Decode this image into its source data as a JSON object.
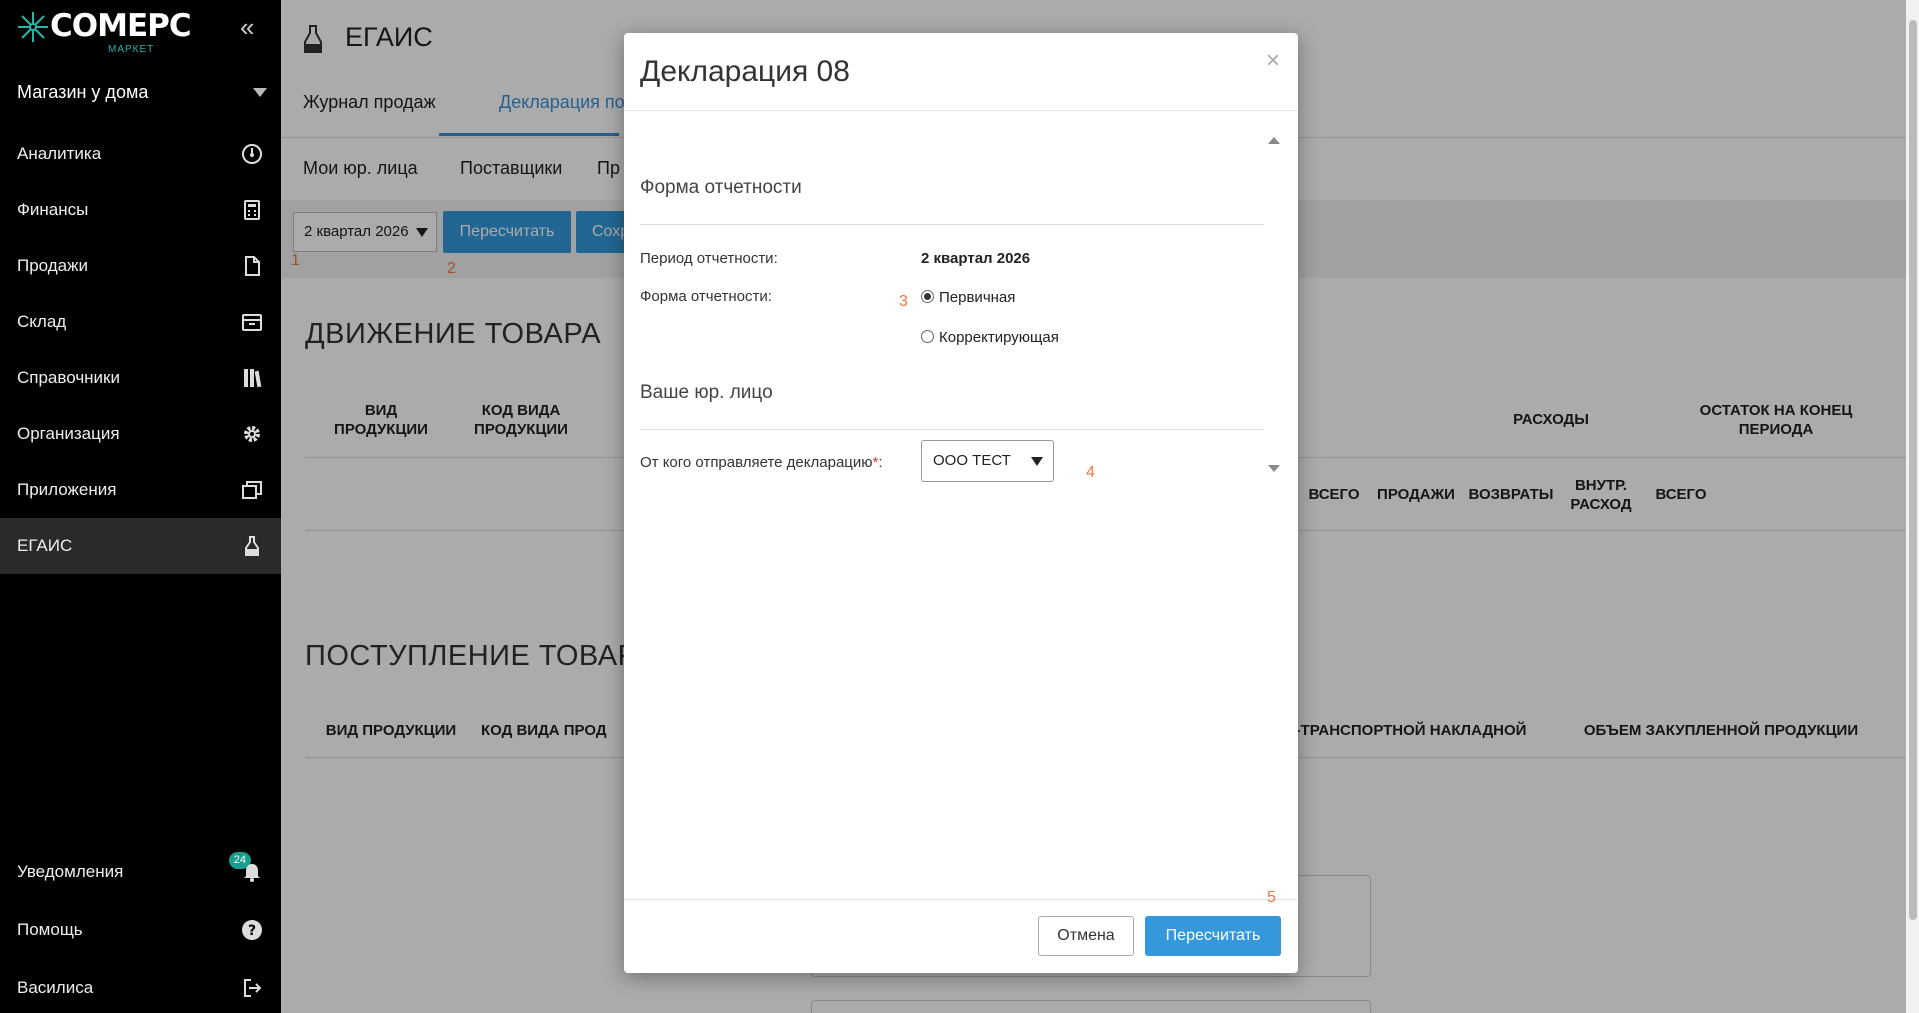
{
  "sidebar": {
    "logo": {
      "brand": "COMEPC",
      "sub": "МАРКЕТ"
    },
    "store": "Магазин у дома",
    "items": [
      {
        "label": "Аналитика",
        "icon": "gauge-icon"
      },
      {
        "label": "Финансы",
        "icon": "calculator-icon"
      },
      {
        "label": "Продажи",
        "icon": "document-icon"
      },
      {
        "label": "Склад",
        "icon": "box-icon"
      },
      {
        "label": "Справочники",
        "icon": "books-icon"
      },
      {
        "label": "Организация",
        "icon": "gear-icon"
      },
      {
        "label": "Приложения",
        "icon": "windows-icon"
      },
      {
        "label": "ЕГАИС",
        "icon": "flask-icon",
        "active": true
      }
    ],
    "bottom": [
      {
        "label": "Уведомления",
        "icon": "bell-icon",
        "badge": "24"
      },
      {
        "label": "Помощь",
        "icon": "question-icon"
      },
      {
        "label": "Василиса",
        "icon": "logout-icon"
      }
    ]
  },
  "page": {
    "title": "ЕГАИС",
    "tabs": [
      "Журнал продаж",
      "Декларация по п"
    ],
    "subtabs": [
      "Мои юр. лица",
      "Поставщики",
      "Пр"
    ],
    "period": "2 квартал 2026",
    "recalc_button": "Пересчитать",
    "save_button": "Сохр",
    "steps": [
      "1",
      "2",
      "3",
      "4",
      "5"
    ],
    "movement": {
      "title": "ДВИЖЕНИЕ ТОВАРА",
      "headers": [
        "ВИД ПРОДУКЦИИ",
        "КОД ВИДА ПРОДУКЦИИ",
        "РАСХОДЫ",
        "ОСТАТОК НА КОНЕЦ ПЕРИОДА"
      ],
      "subheaders": [
        "ВСЕГО",
        "ПРОДАЖИ",
        "ВОЗВРАТЫ",
        "ВНУТР. РАСХОД",
        "ВСЕГО"
      ]
    },
    "receipt": {
      "title": "ПОСТУПЛЕНИЕ ТОВАРА",
      "headers": [
        "ВИД ПРОДУКЦИИ",
        "КОД ВИДА ПРОД",
        "-ТРАНСПОРТНОЙ НАКЛАДНОЙ",
        "ОБЪЕМ ЗАКУПЛЕННОЙ ПРОДУКЦИИ"
      ]
    }
  },
  "modal": {
    "title": "Декларация 08",
    "close": "×",
    "section_report": "Форма отчетности",
    "period_label": "Период отчетности:",
    "period_value": "2 квартал 2026",
    "form_label": "Форма отчетности:",
    "radio_primary": "Первичная",
    "radio_correcting": "Корректирующая",
    "section_entity": "Ваше юр. лицо",
    "sender_label": "От кого отправляете декларацию",
    "sender_req": "*",
    "sender_colon": ":",
    "sender_value": "ООО ТЕСТ",
    "cancel": "Отмена",
    "submit": "Пересчитать"
  },
  "colors": {
    "accent": "#3498db",
    "sidebar": "#000000",
    "badge": "#179e8e",
    "step": "#f07840"
  }
}
